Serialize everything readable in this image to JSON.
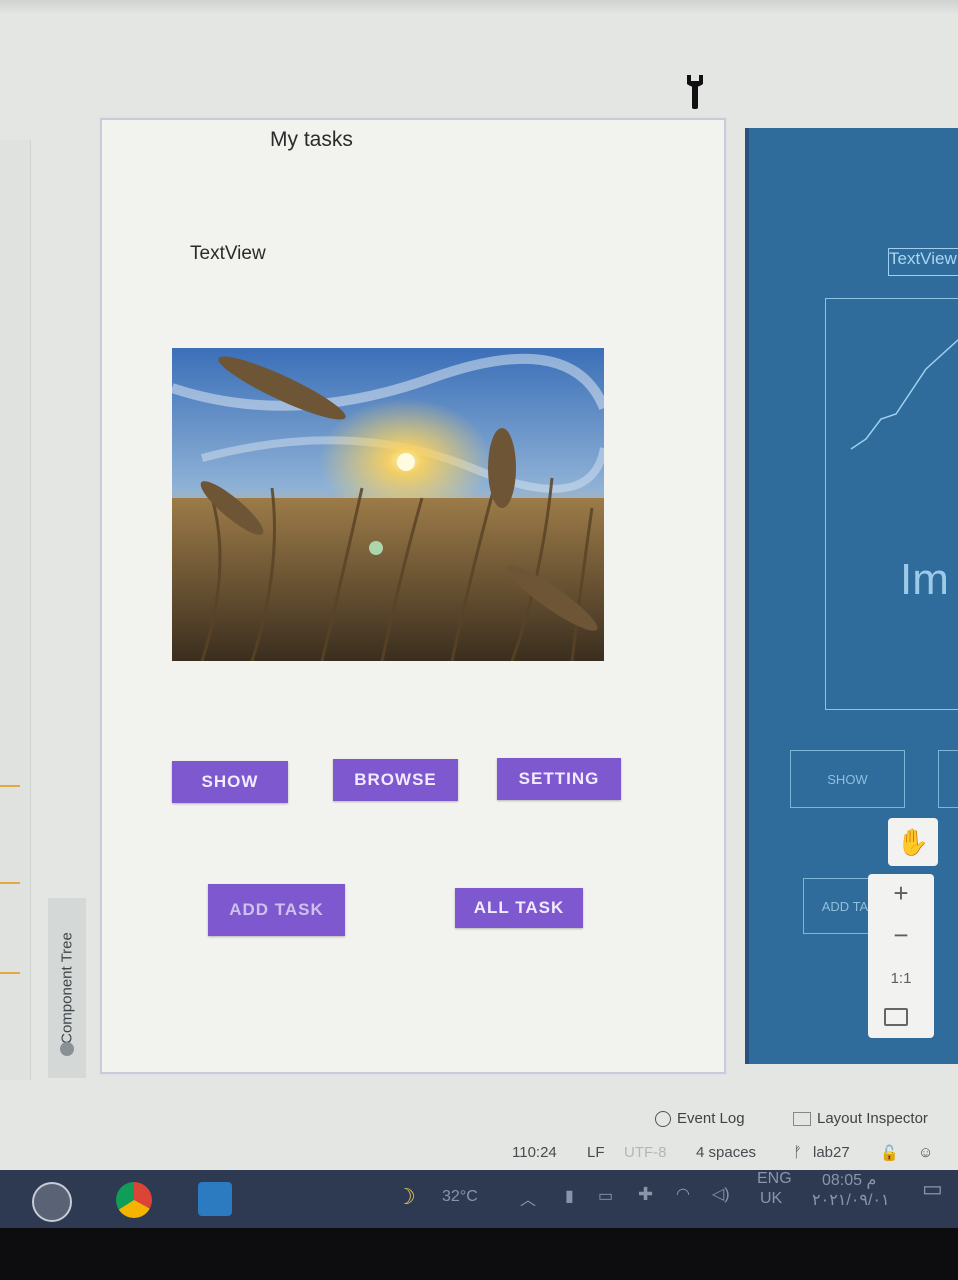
{
  "phone_preview": {
    "title": "My tasks",
    "textview": "TextView",
    "image_subject": "wheat-field-sunset",
    "buttons": {
      "show": "SHOW",
      "browse": "BROWSE",
      "setting": "SETTING",
      "add_task": "ADD TASK",
      "all_task": "ALL TASK"
    }
  },
  "blueprint_preview": {
    "textview": "TextView",
    "image_label": "Im",
    "show": "SHOW",
    "add_task": "ADD TA"
  },
  "side_panel": {
    "component_tree": "Component Tree"
  },
  "zoom_controls": {
    "zoom_in": "+",
    "zoom_out": "−",
    "ratio": "1:1"
  },
  "tool_windows": {
    "event_log": "Event Log",
    "layout_inspector": "Layout Inspector"
  },
  "status_bar": {
    "position": "110:24",
    "line_ending": "LF",
    "encoding": "UTF-8",
    "indent": "4 spaces",
    "branch": "lab27"
  },
  "taskbar": {
    "temperature": "32°C",
    "language_top": "ENG",
    "language_bottom": "UK",
    "time": "08:05 م",
    "date": "٢٠٢١/٠٩/٠١"
  },
  "colors": {
    "button_purple": "#7e58cf",
    "blueprint_blue": "#2f6b9b",
    "taskbar": "#2d3a52"
  }
}
